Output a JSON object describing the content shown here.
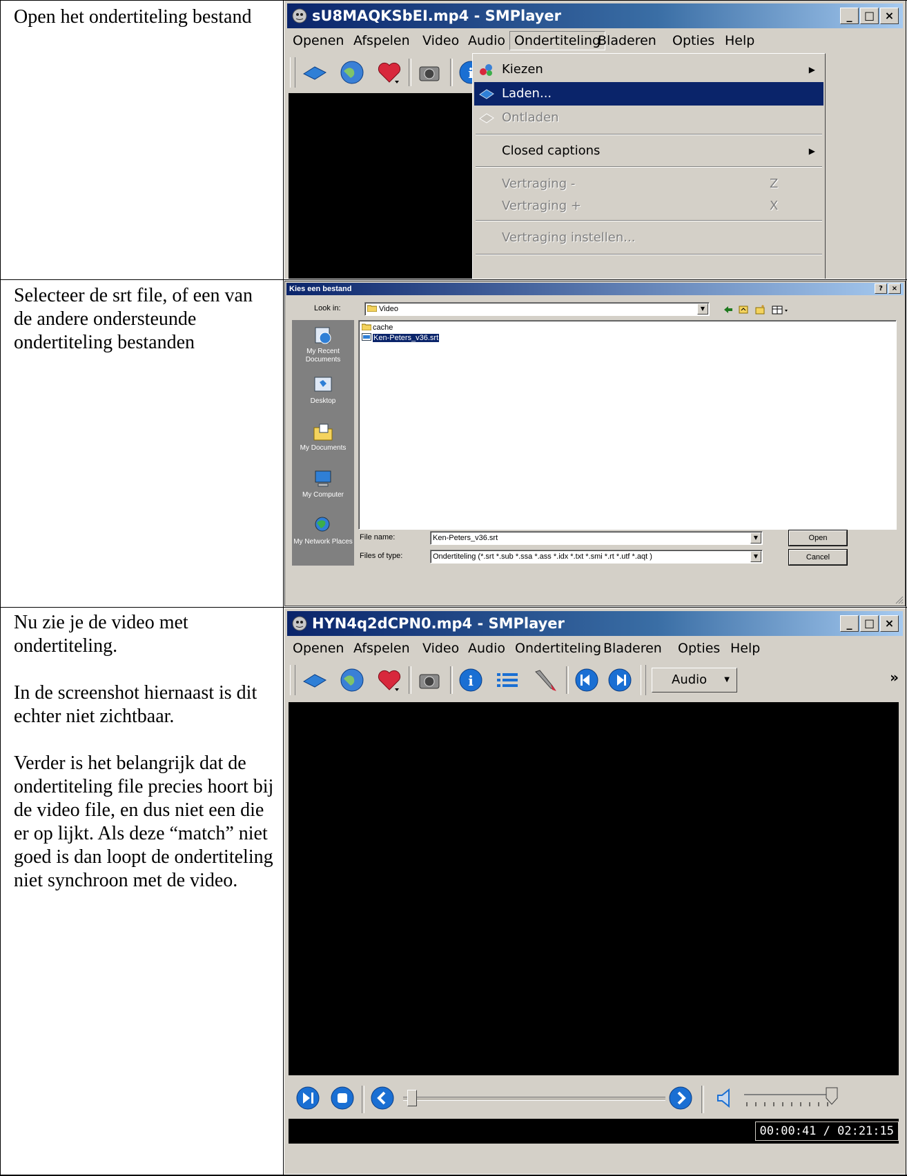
{
  "rows": [
    {
      "paragraphs": [
        "Open het ondertiteling bestand"
      ]
    },
    {
      "paragraphs": [
        "Selecteer de srt file, of een van de andere ondersteunde ondertiteling bestanden"
      ]
    },
    {
      "paragraphs": [
        "Nu zie je de video met ondertiteling.",
        "In de screenshot hiernaast is dit echter niet zichtbaar.",
        "Verder is het belangrijk dat de ondertiteling file precies hoort bij de video file, en dus niet een die er op lijkt. Als deze “match” niet goed is dan loopt de ondertiteling niet synchroon met de video."
      ]
    }
  ],
  "shot1": {
    "title": "sU8MAQKSbEI.mp4 - SMPlayer",
    "menu": [
      "Openen",
      "Afspelen",
      "Video",
      "Audio",
      "Ondertiteling",
      "Bladeren",
      "Opties",
      "Help"
    ],
    "menu_selected": "Ondertiteling",
    "submenu": {
      "items": [
        {
          "label": "Kiezen",
          "icon": "subtitles-choose-icon",
          "state": "normal",
          "submenu": true
        },
        {
          "label": "Laden...",
          "icon": "load-subtitle-icon",
          "state": "selected"
        },
        {
          "label": "Ontladen",
          "icon": "unload-subtitle-icon",
          "state": "disabled"
        },
        {
          "label": "Closed captions",
          "state": "normal",
          "submenu": true
        },
        {
          "label": "Vertraging -",
          "shortcut": "Z",
          "state": "disabled"
        },
        {
          "label": "Vertraging +",
          "shortcut": "X",
          "state": "disabled"
        },
        {
          "label": "Vertraging instellen...",
          "state": "disabled"
        }
      ]
    },
    "window_buttons": [
      "_",
      "□",
      "×"
    ]
  },
  "shot2": {
    "title": "Kies een bestand",
    "title_buttons": [
      "?",
      "×"
    ],
    "look_in_label": "Look in:",
    "look_in_value": "Video",
    "places": [
      "My Recent Documents",
      "Desktop",
      "My Documents",
      "My Computer",
      "My Network Places"
    ],
    "files": [
      {
        "name": "cache",
        "type": "folder",
        "selected": false
      },
      {
        "name": "Ken-Peters_v36.srt",
        "type": "file",
        "selected": true
      }
    ],
    "file_name_label": "File name:",
    "file_name_value": "Ken-Peters_v36.srt",
    "files_of_type_label": "Files of type:",
    "files_of_type_value": "Ondertiteling (*.srt *.sub *.ssa *.ass *.idx *.txt *.smi *.rt *.utf *.aqt )",
    "open_button": "Open",
    "cancel_button": "Cancel"
  },
  "shot3": {
    "title": "HYN4q2dCPN0.mp4 - SMPlayer",
    "menu": [
      "Openen",
      "Afspelen",
      "Video",
      "Audio",
      "Ondertiteling",
      "Bladeren",
      "Opties",
      "Help"
    ],
    "audio_dropdown": "Audio",
    "overflow": "»",
    "time": "00:00:41 / 02:21:15",
    "window_buttons": [
      "_",
      "□",
      "×"
    ]
  }
}
